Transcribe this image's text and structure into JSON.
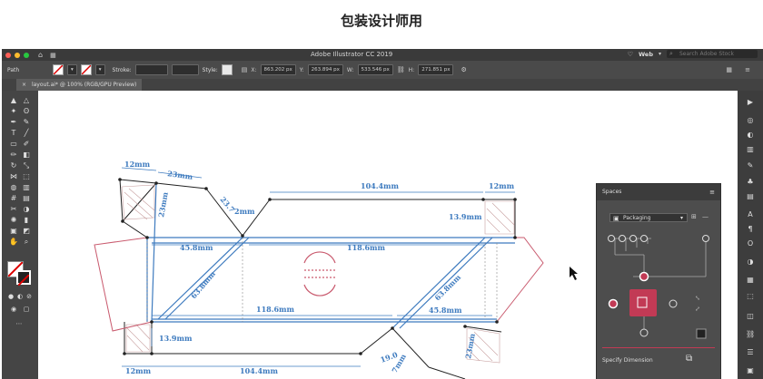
{
  "page": {
    "heading": "包装设计师用"
  },
  "window": {
    "title": "Adobe Illustrator CC 2019",
    "workspace": "Web",
    "search_placeholder": "Search Adobe Stock"
  },
  "control_bar": {
    "selection": "Path",
    "stroke_label": "Stroke:",
    "style_label": "Style:",
    "x_value": "863.202 px",
    "y_value": "263.894 px",
    "w_value": "533.546 px",
    "h_value": "271.851 px"
  },
  "document_tab": {
    "label": "layout.ai* @ 100% (RGB/GPU Preview)"
  },
  "dieline": {
    "accent_color": "#3e7bbf",
    "dims": {
      "d12_top": "12mm",
      "d23_top": "23mm",
      "d23_left": "23mm",
      "d23_7": "23.7",
      "d2mm": "2mm",
      "d104_top": "104.4mm",
      "d12_right": "12mm",
      "d13_right": "13.9mm",
      "d45_top": "45.8mm",
      "d118_top": "118.6mm",
      "d63_left": "63.8mm",
      "d63_right": "63.8mm",
      "d118_mid": "118.6mm",
      "d45_bot": "45.8mm",
      "d13_bot": "13.9mm",
      "d12_bot": "12mm",
      "d104_bot": "104.4mm",
      "d19": "19.0",
      "d7": "7mm",
      "d23_bot": "23mm"
    }
  },
  "spaces_panel": {
    "title": "Spaces",
    "dropdown_value": "Packaging",
    "footer_label": "Specify Dimension",
    "accent_color": "#c23a55"
  }
}
